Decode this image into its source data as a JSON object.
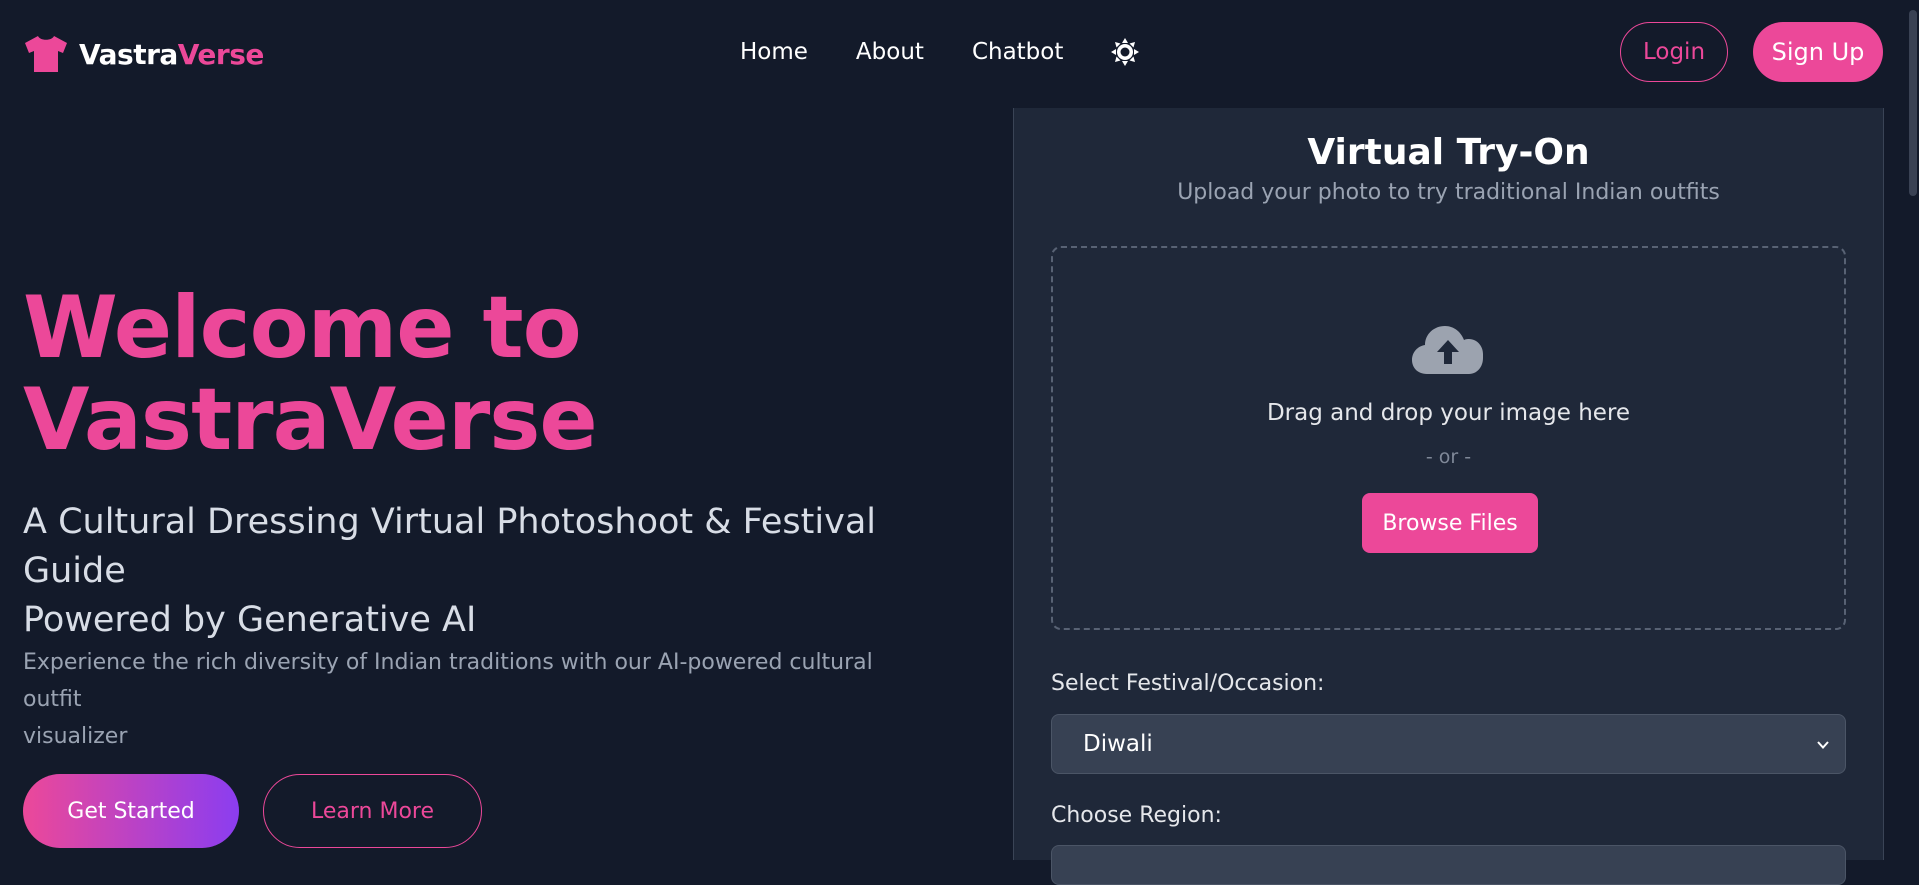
{
  "header": {
    "logo_part1": "Vastra",
    "logo_part2": "Verse",
    "logo_icon": "tshirt-icon",
    "nav": [
      "Home",
      "About",
      "Chatbot"
    ],
    "theme_icon": "sun-icon",
    "login_label": "Login",
    "signup_label": "Sign Up"
  },
  "hero": {
    "title_line1": "Welcome to",
    "title_line2": "VastraVerse",
    "subtitle_line1": "A Cultural Dressing Virtual Photoshoot & Festival Guide",
    "subtitle_line2": "Powered by Generative AI",
    "description_line1": "Experience the rich diversity of Indian traditions with our AI-powered cultural outfit",
    "description_line2": "visualizer",
    "get_started_label": "Get Started",
    "learn_more_label": "Learn More"
  },
  "tryon": {
    "title": "Virtual Try-On",
    "subtitle": "Upload your photo to try traditional Indian outfits",
    "upload_icon": "cloud-upload-icon",
    "drop_text": "Drag and drop your image here",
    "or_text": "- or -",
    "browse_label": "Browse Files",
    "festival_label": "Select Festival/Occasion:",
    "festival_value": "Diwali",
    "region_label": "Choose Region:"
  },
  "colors": {
    "background": "#131a2a",
    "panel": "#1f2839",
    "accent": "#ec4899",
    "gradient_end": "#8b3df0"
  }
}
